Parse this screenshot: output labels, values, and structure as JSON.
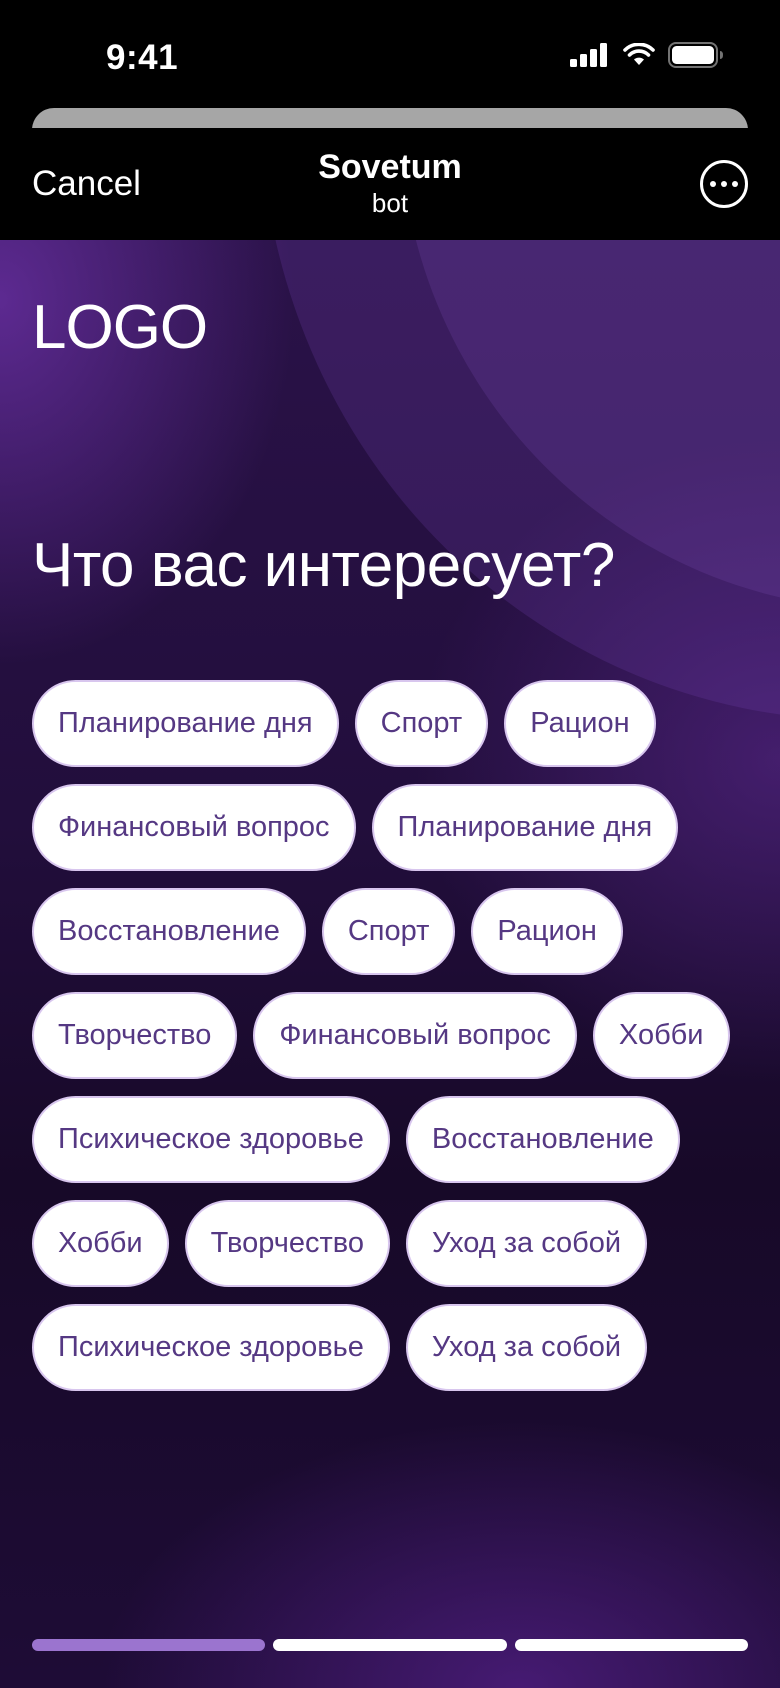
{
  "status_bar": {
    "time": "9:41",
    "icons": [
      "cellular-signal-icon",
      "wifi-icon",
      "battery-icon"
    ]
  },
  "nav": {
    "cancel_label": "Cancel",
    "title": "Sovetum",
    "subtitle": "bot",
    "more_icon": "more-icon"
  },
  "main": {
    "logo": "LOGO",
    "heading": "Что вас интересует?",
    "chip_rows": [
      [
        "Планирование дня",
        "Спорт",
        "Рацион"
      ],
      [
        "Финансовый вопрос",
        "Планирование дня"
      ],
      [
        "Восстановление",
        "Спорт",
        "Рацион"
      ],
      [
        "Творчество",
        "Финансовый вопрос",
        "Хобби"
      ],
      [
        "Психическое здоровье",
        "Восстановление"
      ],
      [
        "Хобби",
        "Творчество",
        "Уход за собой"
      ],
      [
        "Психическое здоровье",
        "Уход за собой"
      ]
    ]
  },
  "progress": {
    "total_steps": 3,
    "current_step": 1
  },
  "colors": {
    "background": "#1c0b33",
    "chip_background": "#ffffff",
    "chip_text": "#553883",
    "progress_active": "#9b74cf",
    "progress_inactive": "#ffffff"
  }
}
